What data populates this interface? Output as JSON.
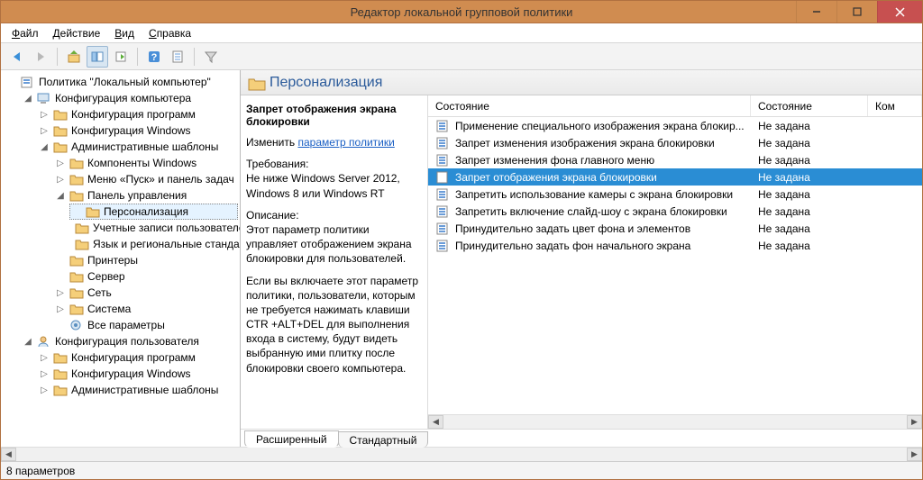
{
  "window": {
    "title": "Редактор локальной групповой политики"
  },
  "win_buttons": {
    "min": "—",
    "max": "▢",
    "close": "✕"
  },
  "menu": {
    "file": "Файл",
    "action": "Действие",
    "view": "Вид",
    "help": "Справка"
  },
  "tree": {
    "root": "Политика \"Локальный компьютер\"",
    "comp_config": "Конфигурация компьютера",
    "prog_config": "Конфигурация программ",
    "win_config": "Конфигурация Windows",
    "admin_tpl": "Административные шаблоны",
    "win_components": "Компоненты Windows",
    "start_taskbar": "Меню «Пуск» и панель задач",
    "control_panel": "Панель управления",
    "personalization": "Персонализация",
    "user_accounts": "Учетные записи пользователей",
    "lang_region": "Язык и региональные стандарты",
    "printers": "Принтеры",
    "server": "Сервер",
    "network": "Сеть",
    "system": "Система",
    "all_params": "Все параметры",
    "user_config": "Конфигурация пользователя",
    "u_prog_config": "Конфигурация программ",
    "u_win_config": "Конфигурация Windows",
    "u_admin_tpl": "Административные шаблоны"
  },
  "right_header": {
    "title": "Персонализация"
  },
  "description": {
    "name": "Запрет отображения экрана блокировки",
    "edit_label": "Изменить",
    "edit_link": "параметр политики",
    "req_label": "Требования:",
    "req_text": "Не ниже Windows Server 2012, Windows 8 или Windows RT",
    "desc_label": "Описание:",
    "desc_p1": "Этот параметр политики управляет отображением экрана блокировки для пользователей.",
    "desc_p2": "Если вы включаете этот параметр политики, пользователи, которым не требуется нажимать клавиши CTR +ALT+DEL для выполнения входа в систему, будут видеть выбранную ими плитку после блокировки своего компьютера."
  },
  "columns": {
    "state_header": "Состояние",
    "state2": "Состояние",
    "comment": "Ком"
  },
  "rows": [
    {
      "name": "Применение специального изображения экрана блокир...",
      "state": "Не задана",
      "selected": false
    },
    {
      "name": "Запрет изменения изображения экрана блокировки",
      "state": "Не задана",
      "selected": false
    },
    {
      "name": "Запрет изменения фона главного меню",
      "state": "Не задана",
      "selected": false
    },
    {
      "name": "Запрет отображения экрана блокировки",
      "state": "Не задана",
      "selected": true
    },
    {
      "name": "Запретить использование камеры с экрана блокировки",
      "state": "Не задана",
      "selected": false
    },
    {
      "name": "Запретить включение слайд-шоу с экрана блокировки",
      "state": "Не задана",
      "selected": false
    },
    {
      "name": "Принудительно задать цвет фона и элементов",
      "state": "Не задана",
      "selected": false
    },
    {
      "name": "Принудительно задать фон начального экрана",
      "state": "Не задана",
      "selected": false
    }
  ],
  "tabs": {
    "ext": "Расширенный",
    "std": "Стандартный"
  },
  "status": {
    "text": "8 параметров"
  }
}
